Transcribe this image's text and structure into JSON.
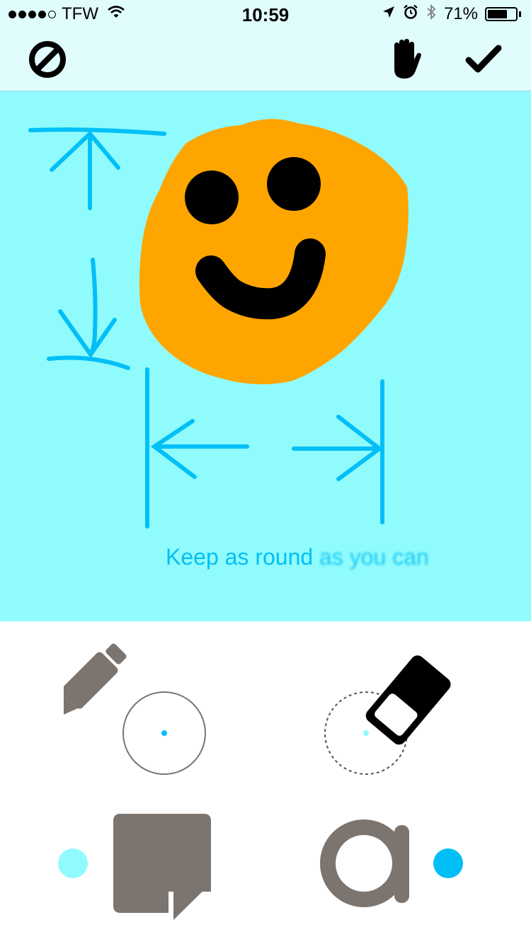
{
  "status_bar": {
    "carrier": "TFW",
    "time": "10:59",
    "battery_percent": "71%",
    "battery_level": 0.71,
    "signal_bars": 4,
    "signal_max": 5,
    "icons": [
      "wifi-icon",
      "location-arrow-icon",
      "alarm-icon",
      "bluetooth-icon",
      "battery-icon"
    ]
  },
  "toolbar": {
    "icons": [
      "cancel-icon",
      "hand-icon",
      "checkmark-icon"
    ]
  },
  "canvas": {
    "caption_visible": "Keep as round",
    "caption_partial": "as you can",
    "colors": {
      "background": "#90fbfc",
      "stroke": "#00bff7",
      "face": "#ffa500",
      "features": "#000000"
    }
  },
  "tools": {
    "icons": [
      "pen-icon",
      "eraser-icon",
      "paper-icon",
      "text-icon"
    ],
    "colors": {
      "tool_gray": "#7c756f",
      "paper_swatch": "#90fbfc",
      "text_swatch": "#00bff7"
    }
  }
}
